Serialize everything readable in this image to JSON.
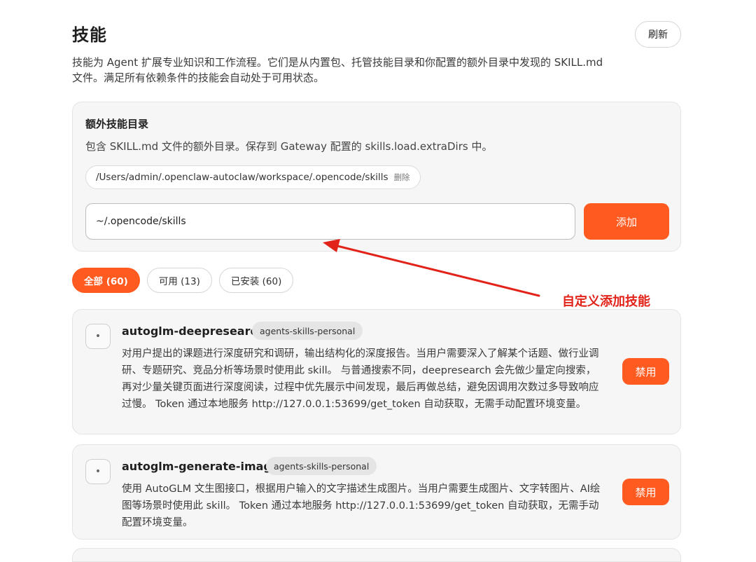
{
  "header": {
    "title": "技能",
    "refresh_label": "刷新",
    "description": "技能为 Agent 扩展专业知识和工作流程。它们是从内置包、托管技能目录和你配置的额外目录中发现的 SKILL.md 文件。满足所有依赖条件的技能会自动处于可用状态。"
  },
  "extra_dirs": {
    "title": "额外技能目录",
    "description": "包含 SKILL.md 文件的额外目录。保存到 Gateway 配置的 skills.load.extraDirs 中。",
    "dirs": [
      {
        "path": "/Users/admin/.openclaw-autoclaw/workspace/.opencode/skills",
        "delete_label": "删除"
      }
    ],
    "input_value": "~/.opencode/skills",
    "add_label": "添加"
  },
  "filters": {
    "tabs": [
      {
        "label": "全部 (60)",
        "active": true
      },
      {
        "label": "可用 (13)",
        "active": false
      },
      {
        "label": "已安装 (60)",
        "active": false
      }
    ]
  },
  "annotation": {
    "label": "自定义添加技能",
    "color": "#e2231a"
  },
  "skills": [
    {
      "name": "autoglm-deepresearch",
      "tag": "agents-skills-personal",
      "description": "对用户提出的课题进行深度研究和调研，输出结构化的深度报告。当用户需要深入了解某个话题、做行业调研、专题研究、竞品分析等场景时使用此 skill。 与普通搜索不同，deepresearch 会先做少量定向搜索，再对少量关键页面进行深度阅读，过程中优先展示中间发现，最后再做总结，避免因调用次数过多导致响应过慢。 Token 通过本地服务 http://127.0.0.1:53699/get_token 自动获取，无需手动配置环境变量。",
      "action_label": "禁用"
    },
    {
      "name": "autoglm-generate-image",
      "tag": "agents-skills-personal",
      "description": "使用 AutoGLM 文生图接口，根据用户输入的文字描述生成图片。当用户需要生成图片、文字转图片、AI绘图等场景时使用此 skill。 Token 通过本地服务 http://127.0.0.1:53699/get_token 自动获取，无需手动配置环境变量。",
      "action_label": "禁用"
    }
  ],
  "colors": {
    "accent": "#ff5a1f",
    "card_background": "#f6f6f6"
  }
}
